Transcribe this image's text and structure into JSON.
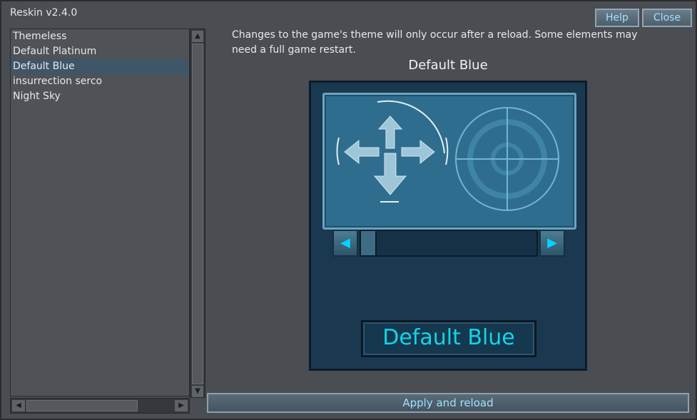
{
  "window": {
    "title": "Reskin v2.4.0"
  },
  "buttons": {
    "help": "Help",
    "close": "Close",
    "apply": "Apply and reload"
  },
  "themes": [
    {
      "label": "Themeless",
      "selected": false
    },
    {
      "label": "Default Platinum",
      "selected": false
    },
    {
      "label": "Default Blue",
      "selected": true
    },
    {
      "label": "insurrection serco",
      "selected": false
    },
    {
      "label": "Night Sky",
      "selected": false
    }
  ],
  "description": "Changes to the game's theme will only occur after a reload. Some elements may need a full game restart.",
  "preview": {
    "title": "Default Blue",
    "label": "Default Blue",
    "slider_left": "◀",
    "slider_right": "▶"
  },
  "icons": {
    "scroll_up": "▲",
    "scroll_down": "▼",
    "scroll_left": "◀",
    "scroll_right": "▶"
  },
  "colors": {
    "accent_text": "#9fe0ff",
    "preview_bg": "#1b3851",
    "preview_panel": "#2f6d8f",
    "preview_label_text": "#12d4e8"
  }
}
